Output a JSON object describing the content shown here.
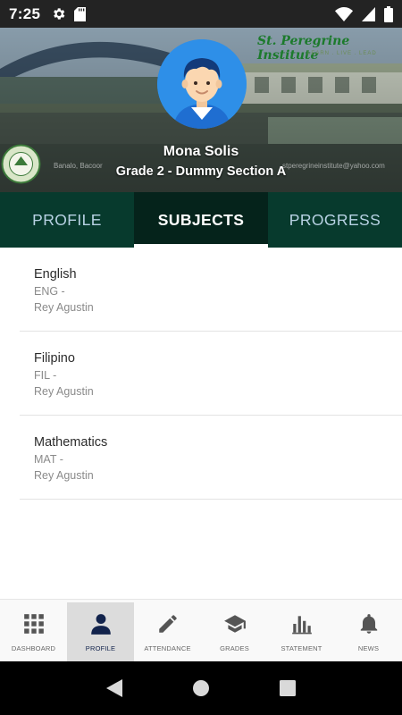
{
  "status_bar": {
    "time": "7:25",
    "icons": [
      "settings-icon",
      "sd-card-icon",
      "wifi-icon",
      "signal-icon",
      "battery-icon"
    ]
  },
  "header": {
    "banner": {
      "school_name": "St. Peregrine Institute",
      "tagline": "LEARN . LIVE . LEAD",
      "address": "Banalo, Bacoor",
      "email": "stperegrineinstitute@yahoo.com"
    },
    "student_name": "Mona  Solis",
    "section": "Grade 2 - Dummy Section A"
  },
  "tabs": [
    {
      "label": "PROFILE",
      "active": false
    },
    {
      "label": "SUBJECTS",
      "active": true
    },
    {
      "label": "PROGRESS",
      "active": false
    }
  ],
  "subjects": [
    {
      "name": "English",
      "code": "ENG -",
      "teacher": "Rey  Agustin"
    },
    {
      "name": "Filipino",
      "code": "FIL -",
      "teacher": "Rey  Agustin"
    },
    {
      "name": "Mathematics",
      "code": "MAT -",
      "teacher": "Rey  Agustin"
    }
  ],
  "bottom_nav": [
    {
      "label": "DASHBOARD",
      "icon": "grid-icon",
      "active": false
    },
    {
      "label": "PROFILE",
      "icon": "person-icon",
      "active": true
    },
    {
      "label": "ATTENDANCE",
      "icon": "pencil-icon",
      "active": false
    },
    {
      "label": "GRADES",
      "icon": "graduation-cap-icon",
      "active": false
    },
    {
      "label": "STATEMENT",
      "icon": "bar-chart-icon",
      "active": false
    },
    {
      "label": "NEWS",
      "icon": "bell-icon",
      "active": false
    }
  ],
  "colors": {
    "tab_bar": "#073a2d",
    "tab_active": "#05231b",
    "tab_inactive_text": "#b8d2e4",
    "nav_active_icon": "#12234c",
    "avatar_background": "#2e8fe8"
  }
}
